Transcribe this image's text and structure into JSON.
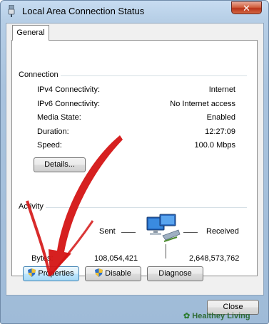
{
  "window": {
    "title": "Local Area Connection Status",
    "close_glyph": "✕"
  },
  "tabs": [
    {
      "label": "General"
    }
  ],
  "connection": {
    "heading": "Connection",
    "rows": [
      {
        "label": "IPv4 Connectivity:",
        "value": "Internet"
      },
      {
        "label": "IPv6 Connectivity:",
        "value": "No Internet access"
      },
      {
        "label": "Media State:",
        "value": "Enabled"
      },
      {
        "label": "Duration:",
        "value": "12:27:09"
      },
      {
        "label": "Speed:",
        "value": "100.0 Mbps"
      }
    ],
    "details_label": "Details..."
  },
  "activity": {
    "heading": "Activity",
    "sent_label": "Sent",
    "received_label": "Received",
    "bytes_label": "Bytes:",
    "bytes_sent": "108,054,421",
    "bytes_received": "2,648,573,762",
    "icon": "network-computers-icon"
  },
  "buttons": {
    "properties": "Properties",
    "disable": "Disable",
    "diagnose": "Diagnose",
    "close": "Close"
  },
  "watermark": {
    "brand_prefix": "✿",
    "brand_name": "Healthey Living"
  },
  "colors": {
    "title_bar": "#b6cee6",
    "close_button": "#c7442a",
    "arrow": "#d41414"
  }
}
